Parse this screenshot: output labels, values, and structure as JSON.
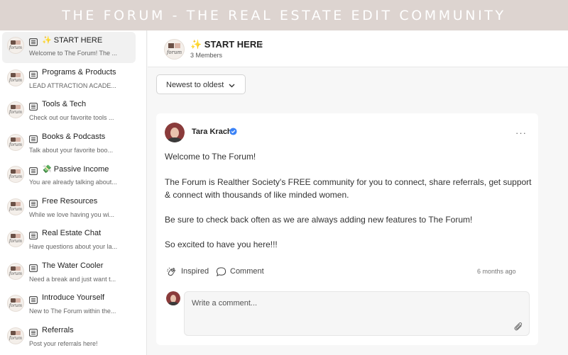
{
  "banner": {
    "title": "THE FORUM - THE REAL ESTATE EDIT COMMUNITY"
  },
  "sidebar": {
    "items": [
      {
        "title": "✨ START HERE",
        "subtitle": "Welcome to The Forum! The ...",
        "active": true,
        "icon": "feed-icon",
        "avatar_text": "forum"
      },
      {
        "title": "Programs & Products",
        "subtitle": "LEAD ATTRACTION ACADE...",
        "active": false,
        "icon": "feed-icon",
        "avatar_text": "forum"
      },
      {
        "title": "Tools & Tech",
        "subtitle": "Check out our favorite tools ...",
        "active": false,
        "icon": "feed-icon",
        "avatar_text": "forum"
      },
      {
        "title": "Books & Podcasts",
        "subtitle": "Talk about your favorite boo...",
        "active": false,
        "icon": "feed-icon",
        "avatar_text": "forum"
      },
      {
        "title": "💸 Passive Income",
        "subtitle": "You are already talking about...",
        "active": false,
        "icon": "feed-icon",
        "avatar_text": "forum"
      },
      {
        "title": "Free Resources",
        "subtitle": "While we love having you wi...",
        "active": false,
        "icon": "feed-icon",
        "avatar_text": "forum"
      },
      {
        "title": "Real Estate Chat",
        "subtitle": "Have questions about your la...",
        "active": false,
        "icon": "feed-icon",
        "avatar_text": "forum"
      },
      {
        "title": "The Water Cooler",
        "subtitle": "Need a break and just want t...",
        "active": false,
        "icon": "feed-icon",
        "avatar_text": "forum"
      },
      {
        "title": "Introduce Yourself",
        "subtitle": "New to The Forum within the...",
        "active": false,
        "icon": "feed-icon",
        "avatar_text": "forum"
      },
      {
        "title": "Referrals",
        "subtitle": "Post your referrals here!",
        "active": false,
        "icon": "feed-icon",
        "avatar_text": "forum"
      }
    ]
  },
  "header": {
    "title": "✨ START HERE",
    "members": "3 Members",
    "avatar_text": "forum"
  },
  "sort": {
    "label": "Newest to oldest"
  },
  "post": {
    "author": "Tara Krach",
    "verified": true,
    "more": "···",
    "paragraphs": [
      "Welcome to The Forum!",
      "The Forum is Realther Society's FREE community for you to connect, share referrals, get support & connect with thousands of like minded women.",
      "Be sure to check back often as we are always adding new features to The Forum!",
      "So excited to have you here!!!"
    ],
    "actions": {
      "inspired": "Inspired",
      "comment": "Comment"
    },
    "timestamp": "6 months ago",
    "comment_placeholder": "Write a comment..."
  },
  "colors": {
    "banner_bg": "#ddd4d0",
    "verified": "#3b82f6",
    "active_item_bg": "#f1f1f1"
  }
}
